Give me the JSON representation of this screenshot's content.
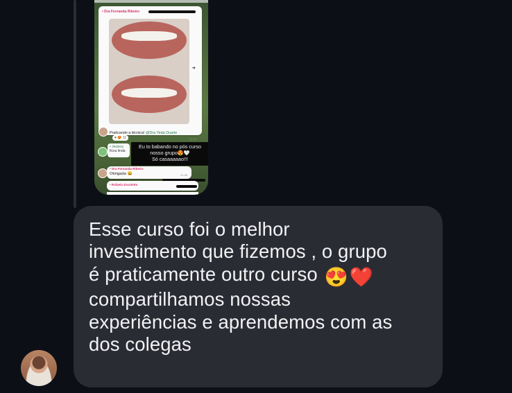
{
  "embed": {
    "post_author": "• Dra Fernanda Ribeiro",
    "caption_prefix": "Praticando a técnica!",
    "caption_mention": "@Dra.Yeda Duarte",
    "caption_time": "21:36",
    "reactions": "♥ 😍 11",
    "reply_author": "• Jessica",
    "reply_text": "ficou linda",
    "sticker_line1": "Eu to babando no pós curso",
    "sticker_line2": "nosso grupo😍🤍",
    "sticker_line3": "Só casaaaaao!!!",
    "thanks_author": "• Dra Fernanda Ribeiro",
    "thanks_text": "Obrigada 😄",
    "thanks_time": "21:48",
    "next_author": "• Rafaela Zocoletto"
  },
  "message": {
    "lines": [
      "Esse curso foi o melhor",
      "investimento que fizemos , o grupo",
      "é  praticamente outro curso",
      "compartilhamos nossas",
      "experiências e aprendemos com as",
      "dos colegas"
    ],
    "emoji_1": "😍",
    "emoji_2": "❤️"
  },
  "colors": {
    "background": "#0d0f17",
    "bubble": "#2a2c34",
    "text": "#f2f2f4"
  }
}
